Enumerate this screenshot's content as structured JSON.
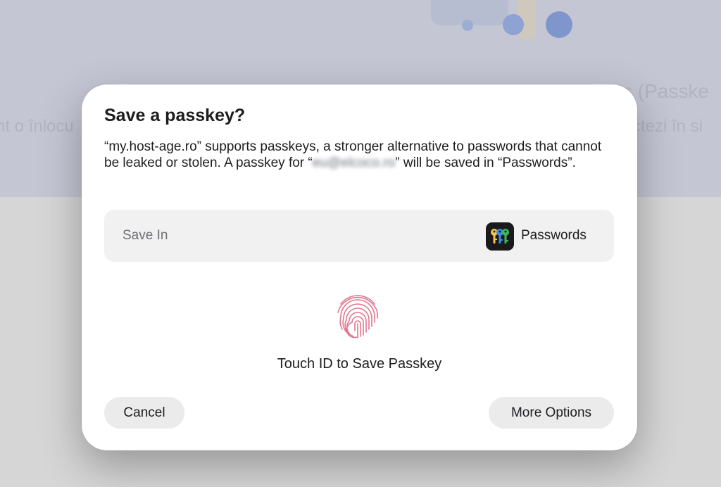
{
  "background": {
    "heading_fragment": "s (Passke",
    "left_fragment": "nt o înlocu",
    "right_fragment": "ctezi în si"
  },
  "dialog": {
    "title": "Save a passkey?",
    "description_part1": "“my.host-age.ro” supports passkeys, a stronger alternative to passwords that cannot be leaked or stolen. A passkey for “",
    "account_email": "eu@elcoco.ro",
    "description_part2": "” will be saved in “Passwords”.",
    "save_in": {
      "label": "Save In",
      "value": "Passwords",
      "app_icon": "passwords-keys-icon"
    },
    "touch_id_label": "Touch ID to Save Passkey",
    "touch_id_icon": "fingerprint-icon",
    "buttons": {
      "cancel": "Cancel",
      "more_options": "More Options"
    }
  },
  "colors": {
    "fingerprint": "#e0788e",
    "key_yellow": "#f5c64a",
    "key_blue": "#3d8ce8",
    "key_green": "#3fb85a"
  }
}
